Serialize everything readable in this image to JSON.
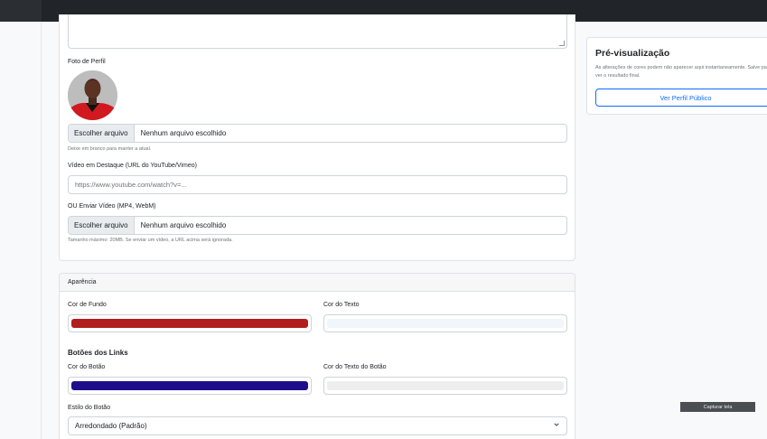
{
  "profile": {
    "photo_label": "Foto de Perfil",
    "photo_file_button": "Escolher arquivo",
    "photo_file_name": "Nenhum arquivo escolhido",
    "photo_help": "Deixe em branco para manter a atual.",
    "video_label": "Vídeo em Destaque (URL do YouTube/Vimeo)",
    "video_placeholder": "https://www.youtube.com/watch?v=...",
    "upload_label": "OU Enviar Vídeo (MP4, WebM)",
    "upload_file_button": "Escolher arquivo",
    "upload_file_name": "Nenhum arquivo escolhido",
    "upload_help": "Tamanho máximo: 20MB. Se enviar um vídeo, a URL acima será ignorada."
  },
  "appearance": {
    "header": "Aparência",
    "bg_color_label": "Cor de Fundo",
    "bg_color": "#b01e1e",
    "text_color_label": "Cor do Texto",
    "text_color": "#f0f6fa",
    "links_title": "Botões dos Links",
    "button_color_label": "Cor do Botão",
    "button_color": "#1e0e8a",
    "button_text_color_label": "Cor do Texto do Botão",
    "button_text_color": "#eeeeee",
    "button_style_label": "Estilo do Botão",
    "button_style_value": "Arredondado (Padrão)"
  },
  "preview": {
    "title": "Pré-visualização",
    "help": "As alterações de cores podem não aparecer aqui instantaneamente. Salve para ver o resultado final.",
    "button": "Ver Perfil Público"
  },
  "capture_button": "Capturar tela"
}
